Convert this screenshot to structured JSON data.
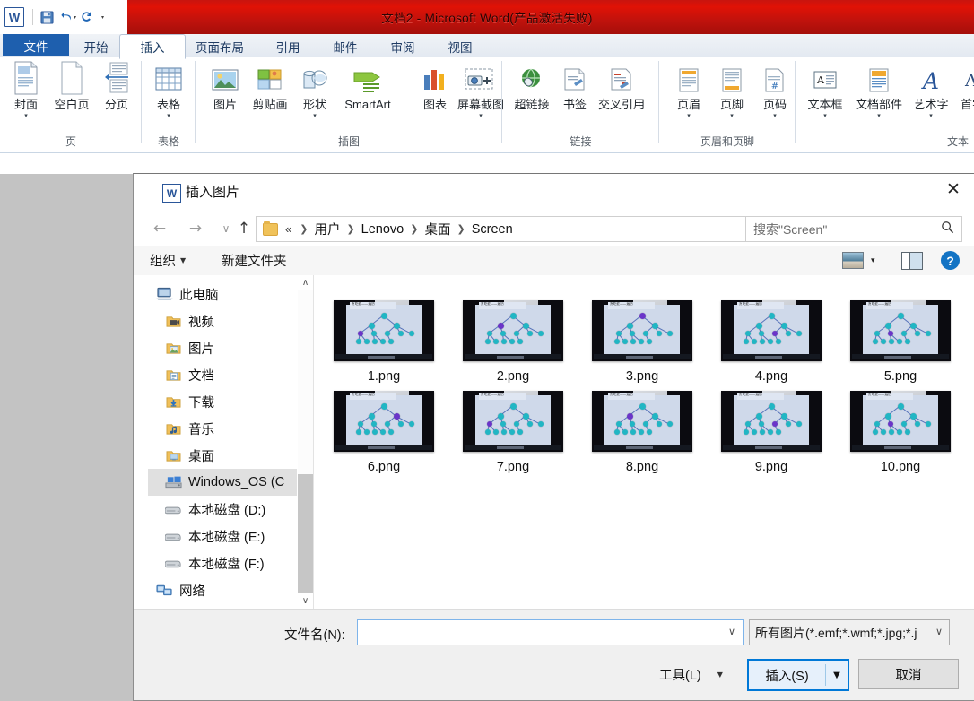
{
  "word": {
    "title": "文档2 - Microsoft Word(产品激活失败)",
    "app_icon": "word-icon",
    "quick_access": [
      {
        "name": "save-icon",
        "glyph": "💾"
      },
      {
        "name": "undo-icon",
        "glyph": "↶"
      },
      {
        "name": "undo-dropdown-icon",
        "glyph": "▾"
      },
      {
        "name": "redo-icon",
        "glyph": "↻"
      },
      {
        "name": "customize-qat-icon",
        "glyph": "▾"
      }
    ],
    "tabs": [
      {
        "label": "文件",
        "state": "file"
      },
      {
        "label": "开始",
        "state": "normal"
      },
      {
        "label": "插入",
        "state": "active"
      },
      {
        "label": "页面布局",
        "state": "normal"
      },
      {
        "label": "引用",
        "state": "normal"
      },
      {
        "label": "邮件",
        "state": "normal"
      },
      {
        "label": "审阅",
        "state": "normal"
      },
      {
        "label": "视图",
        "state": "normal"
      }
    ],
    "ribbon_groups": [
      {
        "name": "页",
        "items": [
          {
            "label": "封面",
            "icon": "cover-page-icon",
            "caret": true
          },
          {
            "label": "空白页",
            "icon": "blank-page-icon",
            "caret": false
          },
          {
            "label": "分页",
            "icon": "page-break-icon",
            "caret": false
          }
        ]
      },
      {
        "name": "表格",
        "items": [
          {
            "label": "表格",
            "icon": "table-icon",
            "caret": true
          }
        ]
      },
      {
        "name": "插图",
        "items": [
          {
            "label": "图片",
            "icon": "picture-icon",
            "caret": false
          },
          {
            "label": "剪贴画",
            "icon": "clipart-icon",
            "caret": false
          },
          {
            "label": "形状",
            "icon": "shapes-icon",
            "caret": true
          },
          {
            "label": "SmartArt",
            "icon": "smartart-icon",
            "caret": false
          },
          {
            "label": "图表",
            "icon": "chart-icon",
            "caret": false
          },
          {
            "label": "屏幕截图",
            "icon": "screenshot-icon",
            "caret": true
          }
        ]
      },
      {
        "name": "链接",
        "items": [
          {
            "label": "超链接",
            "icon": "hyperlink-icon",
            "caret": false
          },
          {
            "label": "书签",
            "icon": "bookmark-icon",
            "caret": false
          },
          {
            "label": "交叉引用",
            "icon": "cross-reference-icon",
            "caret": false
          }
        ]
      },
      {
        "name": "页眉和页脚",
        "items": [
          {
            "label": "页眉",
            "icon": "header-icon",
            "caret": true
          },
          {
            "label": "页脚",
            "icon": "footer-icon",
            "caret": true
          },
          {
            "label": "页码",
            "icon": "page-number-icon",
            "caret": true
          }
        ]
      },
      {
        "name": "文本",
        "items": [
          {
            "label": "文本框",
            "icon": "textbox-icon",
            "caret": true
          },
          {
            "label": "文档部件",
            "icon": "quick-parts-icon",
            "caret": true
          },
          {
            "label": "艺术字",
            "icon": "wordart-icon",
            "caret": true
          },
          {
            "label": "首字",
            "icon": "dropcap-icon",
            "caret": false
          }
        ]
      }
    ]
  },
  "dialog": {
    "title": "插入图片",
    "icon": "word-icon",
    "close_label": "✕",
    "nav": {
      "back_icon": "←",
      "forward_icon": "→",
      "recent_icon": "∨",
      "up_icon": "↑",
      "breadcrumb_prefix": "«",
      "breadcrumbs": [
        "用户",
        "Lenovo",
        "桌面",
        "Screen"
      ],
      "address_dropdown_icon": "∨",
      "refresh_icon": "↻"
    },
    "search": {
      "placeholder": "搜索\"Screen\"",
      "icon": "search-icon"
    },
    "toolbar": {
      "organize_label": "组织",
      "new_folder_label": "新建文件夹",
      "view_icon": "view-layout-icon",
      "view_caret": "▾",
      "preview_pane_icon": "preview-pane-icon",
      "help_icon": "?"
    },
    "nav_pane": {
      "items": [
        {
          "label": "此电脑",
          "icon": "this-pc-icon",
          "selected": false,
          "indent": 0
        },
        {
          "label": "视频",
          "icon": "videos-folder-icon",
          "selected": false,
          "indent": 1
        },
        {
          "label": "图片",
          "icon": "pictures-folder-icon",
          "selected": false,
          "indent": 1
        },
        {
          "label": "文档",
          "icon": "documents-folder-icon",
          "selected": false,
          "indent": 1
        },
        {
          "label": "下载",
          "icon": "downloads-folder-icon",
          "selected": false,
          "indent": 1
        },
        {
          "label": "音乐",
          "icon": "music-folder-icon",
          "selected": false,
          "indent": 1
        },
        {
          "label": "桌面",
          "icon": "desktop-folder-icon",
          "selected": false,
          "indent": 1
        },
        {
          "label": "Windows_OS (C",
          "icon": "windows-drive-icon",
          "selected": true,
          "indent": 1
        },
        {
          "label": "本地磁盘 (D:)",
          "icon": "disk-drive-icon",
          "selected": false,
          "indent": 1
        },
        {
          "label": "本地磁盘 (E:)",
          "icon": "disk-drive-icon",
          "selected": false,
          "indent": 1
        },
        {
          "label": "本地磁盘 (F:)",
          "icon": "disk-drive-icon",
          "selected": false,
          "indent": 1
        },
        {
          "label": "网络",
          "icon": "network-icon",
          "selected": false,
          "indent": 0
        }
      ],
      "scroll_up_icon": "∧",
      "scroll_down_icon": "∨"
    },
    "files": [
      {
        "name": "1.png",
        "highlight_index": 3
      },
      {
        "name": "2.png",
        "highlight_index": 1
      },
      {
        "name": "3.png",
        "highlight_index": 0
      },
      {
        "name": "4.png",
        "highlight_index": 5
      },
      {
        "name": "5.png",
        "highlight_index": 4
      },
      {
        "name": "6.png",
        "highlight_index": 2
      },
      {
        "name": "7.png",
        "highlight_index": 3
      },
      {
        "name": "8.png",
        "highlight_index": 1
      },
      {
        "name": "9.png",
        "highlight_index": 5
      },
      {
        "name": "10.png",
        "highlight_index": 4
      }
    ],
    "thumbnail_caption": "贪吃蛇——遍历",
    "footer": {
      "filename_label": "文件名(N):",
      "filename_value": "",
      "filename_dropdown_icon": "∨",
      "filter_value": "所有图片(*.emf;*.wmf;*.jpg;*.j",
      "filter_dropdown_icon": "∨",
      "tools_label": "工具(L)",
      "tools_caret": "▼",
      "insert_label": "插入(S)",
      "insert_dropdown_icon": "▼",
      "cancel_label": "取消"
    }
  },
  "colors": {
    "titlebar_red": "#d31209",
    "file_tab_blue": "#1e5fae",
    "accent_blue": "#0078d7",
    "desktop_gray": "#c3c3c3",
    "selection_gray": "#e0e0e0"
  }
}
